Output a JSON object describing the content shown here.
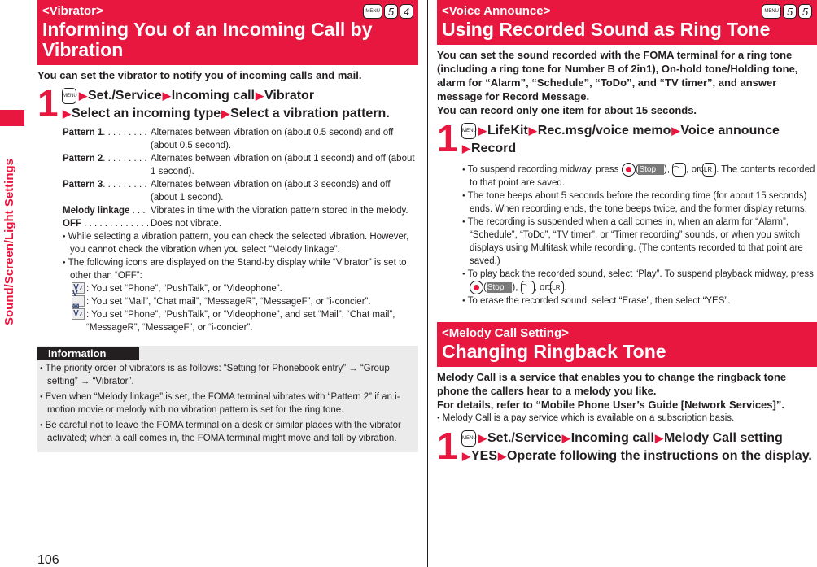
{
  "side": {
    "label": "Sound/Screen/Light Settings"
  },
  "page_number": "106",
  "left": {
    "banner": {
      "sub": "<Vibrator>",
      "title": "Informing You of an Incoming Call by Vibration",
      "keys": [
        "MENU",
        "5",
        "4"
      ]
    },
    "lead": "You can set the vibrator to notify you of incoming calls and mail.",
    "step": {
      "num": "1",
      "menu": "MENU",
      "parts": [
        "Set./Service",
        "Incoming call",
        "Vibrator",
        "Select an incoming type",
        "Select a vibration pattern."
      ]
    },
    "options": [
      {
        "key": "Pattern 1",
        "dots": ". . . . . . . . .",
        "desc": "Alternates between vibration on (about 0.5 second) and off (about 0.5 second)."
      },
      {
        "key": "Pattern 2",
        "dots": ". . . . . . . . .",
        "desc": "Alternates between vibration on (about 1 second) and off (about 1 second)."
      },
      {
        "key": "Pattern 3",
        "dots": ". . . . . . . . .",
        "desc": "Alternates between vibration on (about 3 seconds) and off (about 1 second)."
      },
      {
        "key": "Melody linkage",
        "dots": " . . .",
        "desc": "Vibrates in time with the vibration pattern stored in the melody."
      },
      {
        "key": "OFF",
        "dots": " . . . . . . . . . . . . .",
        "desc": "Does not vibrate."
      }
    ],
    "bullets": [
      "While selecting a vibration pattern, you can check the selected vibration. However, you cannot check the vibration when you select “Melody linkage”.",
      "The following icons are displayed on the Stand-by display while “Vibrator” is set to other than “OFF”:"
    ],
    "icons": [
      {
        "glyph": "V♪",
        "text": ": You set “Phone”, “PushTalk”, or “Videophone”."
      },
      {
        "glyph": "V✉",
        "text": ": You set “Mail”, “Chat mail”, “MessageR”, “MessageF”, or “i-concier”."
      },
      {
        "glyph": "V♪",
        "text": ": You set “Phone”, “PushTalk”, or “Videophone”, and set “Mail”, “Chat mail”, “MessageR”, “MessageF”, or “i-concier”."
      }
    ],
    "info": {
      "tag": "Information",
      "items": [
        "The priority order of vibrators is as follows: “Setting for Phonebook entry” → “Group setting” → “Vibrator”.",
        "Even when “Melody linkage” is set, the FOMA terminal vibrates with “Pattern 2” if an i-motion movie or melody with no vibration pattern is set for the ring tone.",
        "Be careful not to leave the FOMA terminal on a desk or similar places with the vibrator activated; when a call comes in, the FOMA terminal might move and fall by vibration."
      ]
    }
  },
  "right": {
    "banner1": {
      "sub": "<Voice Announce>",
      "title": "Using Recorded Sound as Ring Tone",
      "keys": [
        "MENU",
        "5",
        "5"
      ]
    },
    "lead1": "You can set the sound recorded with the FOMA terminal for a ring tone (including a ring tone for Number B of 2in1), On-hold tone/Holding tone, alarm for “Alarm”, “Schedule”, “ToDo”, and “TV timer”, and answer message for Record Message.",
    "lead2": "You can record only one item for about 15 seconds.",
    "step1": {
      "num": "1",
      "menu": "MENU",
      "parts": [
        "LifeKit",
        "Rec.msg/voice memo",
        "Voice announce",
        "Record"
      ]
    },
    "b1": {
      "pre": "To suspend recording midway, press",
      "stop": "Stop",
      "or": ", or",
      "clr": "CLR",
      "post": ". The contents recorded to that point are saved."
    },
    "b2": "The tone beeps about 5 seconds before the recording time (for about 15 seconds) ends. When recording ends, the tone beeps twice, and the former display returns.",
    "b3": "The recording is suspended when a call comes in, when an alarm for “Alarm”, “Schedule”, “ToDo”, “TV timer”, or “Timer recording” sounds, or when you switch displays using Multitask while recording. (The contents recorded to that point are saved.)",
    "b4": {
      "pre": "To play back the recorded sound, select “Play”. To suspend playback midway, press",
      "stop": "Stop",
      "or": ", or",
      "clr": "CLR",
      "post": "."
    },
    "b5": "To erase the recorded sound, select “Erase”, then select “YES”.",
    "banner2": {
      "sub": "<Melody Call Setting>",
      "title": "Changing Ringback Tone"
    },
    "lead3": "Melody Call is a service that enables you to change the ringback tone phone the callers hear to a melody you like.",
    "lead4": "For details, refer to “Mobile Phone User’s Guide [Network Services]”.",
    "b6": "Melody Call is a pay service which is available on a subscription basis.",
    "step2": {
      "num": "1",
      "menu": "MENU",
      "parts": [
        "Set./Service",
        "Incoming call",
        "Melody Call setting",
        "YES",
        "Operate following the instructions on the display."
      ]
    }
  },
  "colors": {
    "accent": "#e8173f",
    "info_bg": "#ebebeb",
    "text": "#231f20"
  }
}
